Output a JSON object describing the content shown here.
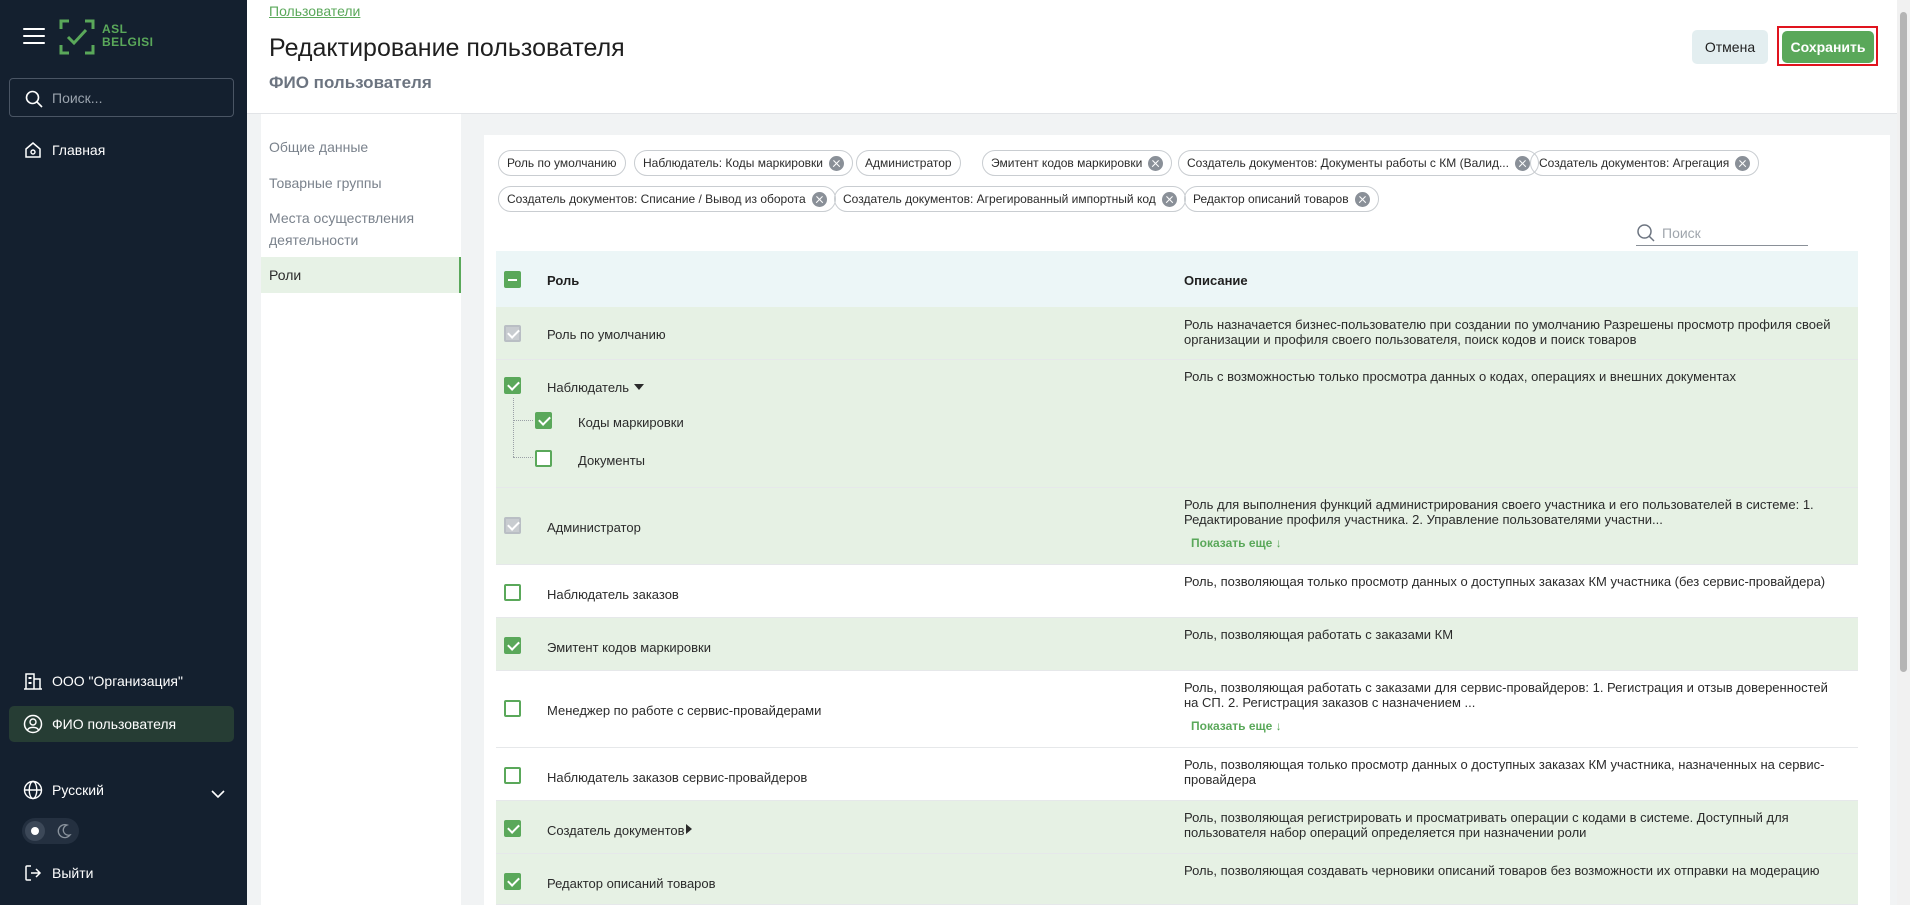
{
  "sidebar": {
    "logo_text_1": "ASL",
    "logo_text_2": "BELGISI",
    "search_placeholder": "Поиск...",
    "home_label": "Главная",
    "org_label": "ООО \"Организация\"",
    "user_label": "ФИО пользователя",
    "language_label": "Русский",
    "logout_label": "Выйти"
  },
  "header": {
    "breadcrumb": "Пользователи",
    "title": "Редактирование пользователя",
    "subtitle": "ФИО пользователя",
    "cancel_label": "Отмена",
    "save_label": "Сохранить"
  },
  "subnav": [
    {
      "label": "Общие данные",
      "active": false
    },
    {
      "label": "Товарные группы",
      "active": false
    },
    {
      "label": "Места осуществления деятельности",
      "active": false
    },
    {
      "label": "Роли",
      "active": true
    }
  ],
  "chips": [
    {
      "label": "Роль по умолчанию",
      "removable": false
    },
    {
      "label": "Наблюдатель: Коды маркировки",
      "removable": true
    },
    {
      "label": "Администратор",
      "removable": false
    },
    {
      "label": "Эмитент кодов маркировки",
      "removable": true
    },
    {
      "label": "Создатель документов: Документы работы с КМ (Валид...",
      "removable": true
    },
    {
      "label": "Создатель документов: Агрегация",
      "removable": true
    },
    {
      "label": "Создатель документов: Списание / Вывод из оборота",
      "removable": true
    },
    {
      "label": "Создатель документов: Агрегированный импортный код",
      "removable": true
    },
    {
      "label": "Редактор описаний товаров",
      "removable": true
    }
  ],
  "table": {
    "search_placeholder": "Поиск",
    "col_role": "Роль",
    "col_desc": "Описание",
    "show_more": "Показать еще ↓",
    "rows": [
      {
        "role": "Роль по умолчанию",
        "desc": "Роль назначается бизнес-пользователю при создании по умолчанию Разрешены просмотр профиля своей организации и профиля своего пользователя, поиск кодов и поиск товаров"
      },
      {
        "role": "Наблюдатель",
        "desc": "Роль с возможностью только просмотра данных о кодах, операциях и внешних документах",
        "sub": [
          "Коды маркировки",
          "Документы"
        ]
      },
      {
        "role": "Администратор",
        "desc": "Роль для выполнения функций администрирования своего участника и его пользователей в системе: 1. Редактирование профиля участника. 2. Управление пользователями участни..."
      },
      {
        "role": "Наблюдатель заказов",
        "desc": "Роль, позволяющая только просмотр данных о доступных заказах КМ участника (без сервис-провайдера)"
      },
      {
        "role": "Эмитент кодов маркировки",
        "desc": "Роль, позволяющая работать с заказами КМ"
      },
      {
        "role": "Менеджер по работе с сервис-провайдерами",
        "desc": "Роль, позволяющая работать с заказами для сервис-провайдеров: 1. Регистрация и отзыв доверенностей на СП. 2. Регистрация заказов с назначением ..."
      },
      {
        "role": "Наблюдатель заказов сервис-провайдеров",
        "desc": "Роль, позволяющая только просмотр данных о доступных заказах КМ участника, назначенных на сервис-провайдера"
      },
      {
        "role": "Создатель документов",
        "desc": "Роль, позволяющая регистрировать и просматривать операции с кодами в системе. Доступный для пользователя набор операций определяется при назначении роли"
      },
      {
        "role": "Редактор описаний товаров",
        "desc": "Роль, позволяющая создавать черновики описаний товаров без возможности их отправки на модерацию"
      }
    ]
  },
  "colors": {
    "accent": "#5aa85a",
    "sidebar_bg": "#14202f",
    "highlight": "#e0141e"
  }
}
